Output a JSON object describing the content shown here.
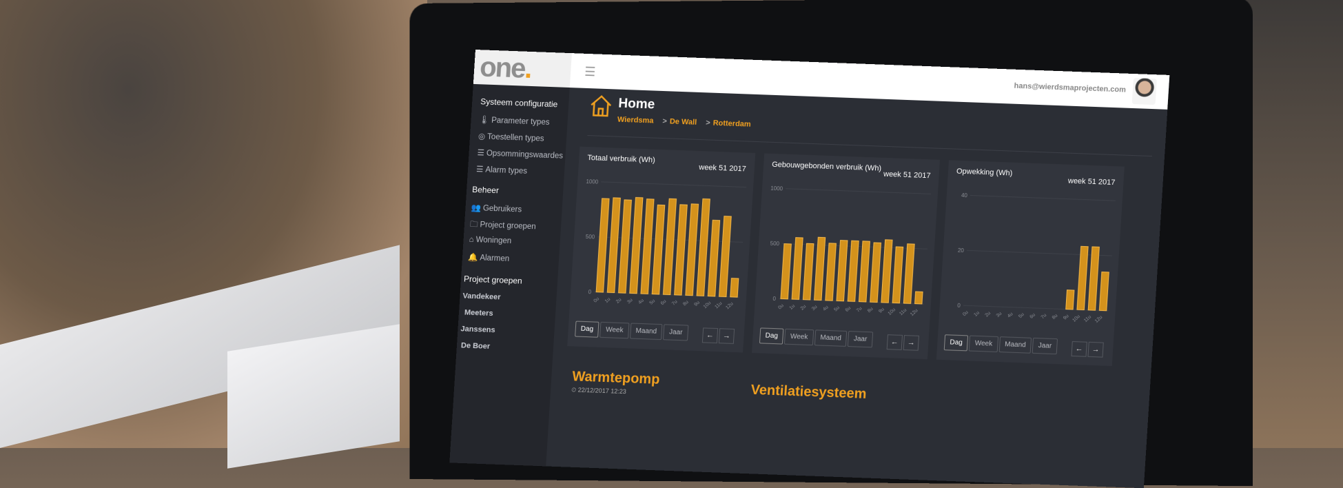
{
  "brand": {
    "logo_text": "one",
    "logo_dot": ".",
    "accent_color": "#f0a020"
  },
  "topbar": {
    "menu_icon": "hamburger-icon",
    "user_email": "hans@wierdsmaprojecten.com"
  },
  "sidebar": {
    "section1": {
      "title": "Systeem configuratie",
      "items": [
        {
          "icon": "thermometer-icon",
          "label": "Parameter types"
        },
        {
          "icon": "target-icon",
          "label": "Toestellen types"
        },
        {
          "icon": "list-icon",
          "label": "Opsommingswaardes"
        },
        {
          "icon": "list-icon",
          "label": "Alarm types"
        }
      ]
    },
    "section2": {
      "title": "Beheer",
      "items": [
        {
          "icon": "users-icon",
          "label": "Gebruikers"
        },
        {
          "icon": "folder-icon",
          "label": "Project groepen"
        },
        {
          "icon": "home-icon",
          "label": "Woningen"
        },
        {
          "icon": "bell-icon",
          "label": "Alarmen"
        }
      ]
    },
    "section3": {
      "title": "Project groepen",
      "items": [
        "Vandekeer",
        "Meeters",
        "Janssens",
        "De Boer"
      ]
    }
  },
  "page": {
    "title": "Home",
    "breadcrumb": [
      "Wierdsma",
      "De Wall",
      "Rotterdam"
    ],
    "breadcrumb_sep": ">"
  },
  "buttons": {
    "dag": "Dag",
    "week": "Week",
    "maand": "Maand",
    "jaar": "Jaar",
    "prev": "←",
    "next": "→"
  },
  "cards": [
    {
      "title": "Totaal verbruik (Wh)",
      "week": "week 51 2017"
    },
    {
      "title": "Gebouwgebonden verbruik (Wh)",
      "week": "week 51 2017"
    },
    {
      "title": "Opwekking (Wh)",
      "week": "week 51 2017"
    }
  ],
  "chart_data": [
    {
      "type": "bar",
      "title": "Totaal verbruik (Wh)",
      "categories": [
        "0u",
        "1u",
        "2u",
        "3u",
        "4u",
        "5u",
        "6u",
        "7u",
        "8u",
        "9u",
        "10u",
        "11u",
        "12u"
      ],
      "values": [
        850,
        860,
        845,
        870,
        860,
        810,
        870,
        820,
        830,
        880,
        690,
        730,
        170
      ],
      "yticks": [
        0,
        500,
        1000
      ],
      "ylim": [
        0,
        1000
      ]
    },
    {
      "type": "bar",
      "title": "Gebouwgebonden verbruik (Wh)",
      "categories": [
        "0u",
        "1u",
        "2u",
        "3u",
        "4u",
        "5u",
        "6u",
        "7u",
        "8u",
        "9u",
        "10u",
        "11u",
        "12u"
      ],
      "values": [
        500,
        560,
        510,
        570,
        520,
        550,
        550,
        550,
        540,
        570,
        510,
        540,
        110
      ],
      "yticks": [
        0,
        500,
        1000
      ],
      "ylim": [
        0,
        1000
      ]
    },
    {
      "type": "bar",
      "title": "Opwekking (Wh)",
      "categories": [
        "0u",
        "1u",
        "2u",
        "3u",
        "4u",
        "5u",
        "6u",
        "7u",
        "8u",
        "9u",
        "10u",
        "11u",
        "12u"
      ],
      "values": [
        0,
        0,
        0,
        0,
        0,
        0,
        0,
        0,
        0,
        7,
        23,
        23,
        14
      ],
      "yticks": [
        0,
        20,
        40
      ],
      "ylim": [
        0,
        40
      ]
    }
  ],
  "sections": [
    {
      "title": "Warmtepomp",
      "date": "22/12/2017 12:23"
    },
    {
      "title": "Ventilatiesysteem"
    }
  ]
}
